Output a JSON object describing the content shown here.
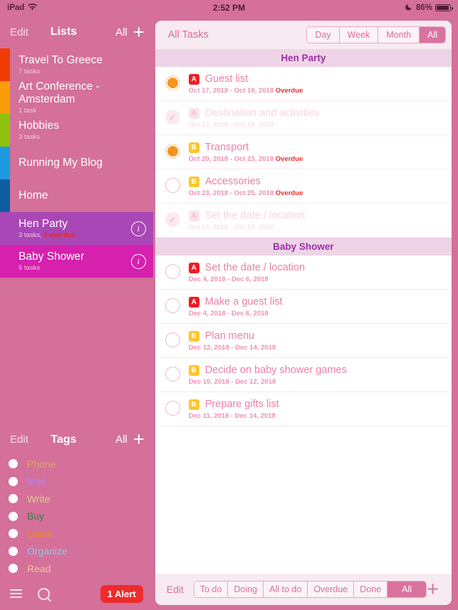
{
  "statusbar": {
    "device": "iPad",
    "wifi_icon": "wifi-icon",
    "time": "2:52 PM",
    "dnd_icon": "moon-icon",
    "battery_text": "86%",
    "battery_level": 86
  },
  "sidebar": {
    "lists_header": {
      "edit_label": "Edit",
      "title": "Lists",
      "all_label": "All",
      "add_label": "+"
    },
    "lists": [
      {
        "name": "Travel To Greece",
        "sub": "7 tasks",
        "overdue": "",
        "color": "#f23c06",
        "selected": false,
        "has_info": false
      },
      {
        "name": "Art Conference - Amsterdam",
        "sub": "1 task",
        "overdue": "",
        "color": "#f99d0b",
        "selected": false,
        "has_info": false
      },
      {
        "name": "Hobbies",
        "sub": "3 tasks",
        "overdue": "",
        "color": "#8fc10d",
        "selected": false,
        "has_info": false
      },
      {
        "name": "Running My Blog",
        "sub": "",
        "overdue": "",
        "color": "#1e9ae0",
        "selected": false,
        "has_info": false
      },
      {
        "name": "Home",
        "sub": "",
        "overdue": "",
        "color": "#0b5f9e",
        "selected": false,
        "has_info": false
      },
      {
        "name": "Hen Party",
        "sub": "3 tasks, ",
        "overdue": "3 overdue",
        "color": "#a847b5",
        "selected": true,
        "has_info": true
      },
      {
        "name": "Baby Shower",
        "sub": "5 tasks",
        "overdue": "",
        "color": "#d521ae",
        "selected": true,
        "has_info": true
      }
    ],
    "tags_header": {
      "edit_label": "Edit",
      "title": "Tags",
      "all_label": "All",
      "add_label": "+"
    },
    "tags": [
      {
        "label": "Phone",
        "color": "#d8a962"
      },
      {
        "label": "Mail",
        "color": "#b183ea"
      },
      {
        "label": "Write",
        "color": "#d8d08a"
      },
      {
        "label": "Buy",
        "color": "#3f7d4e"
      },
      {
        "label": "Learn",
        "color": "#f08c1d"
      },
      {
        "label": "Organize",
        "color": "#93c3e8"
      },
      {
        "label": "Read",
        "color": "#f5c09a"
      }
    ],
    "footer": {
      "menu_icon": "hamburger-menu-icon",
      "search_icon": "search-icon",
      "alert_label": "1 Alert"
    }
  },
  "panel": {
    "header": {
      "title": "All Tasks",
      "segments": [
        {
          "label": "Day",
          "selected": false
        },
        {
          "label": "Week",
          "selected": false
        },
        {
          "label": "Month",
          "selected": false
        },
        {
          "label": "All",
          "selected": true
        }
      ]
    },
    "sections": [
      {
        "title": "Hen Party",
        "tasks": [
          {
            "priority": "A",
            "name": "Guest list",
            "dates": "Oct 17, 2018 - Oct 19, 2018",
            "overdue": "Overdue",
            "state": "doing"
          },
          {
            "priority": "A",
            "name": "Destination and activities",
            "dates": "Oct 17, 2018 - Oct 19, 2018",
            "overdue": "",
            "state": "done"
          },
          {
            "priority": "B",
            "name": "Transport",
            "dates": "Oct 20, 2018 - Oct 23, 2018",
            "overdue": "Overdue",
            "state": "doing"
          },
          {
            "priority": "B",
            "name": "Accessories",
            "dates": "Oct 23, 2018 - Oct 25, 2018",
            "overdue": "Overdue",
            "state": "todo"
          },
          {
            "priority": "A",
            "name": "Set the date / location",
            "dates": "Oct 13, 2018 - Oct 17, 2018",
            "overdue": "",
            "state": "done"
          }
        ]
      },
      {
        "title": "Baby Shower",
        "tasks": [
          {
            "priority": "A",
            "name": "Set the date / location",
            "dates": "Dec 4, 2018 - Dec 6, 2018",
            "overdue": "",
            "state": "todo"
          },
          {
            "priority": "A",
            "name": "Make a guest list",
            "dates": "Dec 4, 2018 - Dec 6, 2018",
            "overdue": "",
            "state": "todo"
          },
          {
            "priority": "B",
            "name": "Plan menu",
            "dates": "Dec 12, 2018 - Dec 14, 2018",
            "overdue": "",
            "state": "todo"
          },
          {
            "priority": "B",
            "name": "Decide on baby shower games",
            "dates": "Dec 10, 2018 - Dec 12, 2018",
            "overdue": "",
            "state": "todo"
          },
          {
            "priority": "B",
            "name": "Prepare gifts list",
            "dates": "Dec 11, 2018 - Dec 14, 2018",
            "overdue": "",
            "state": "todo"
          }
        ]
      }
    ],
    "footer": {
      "edit_label": "Edit",
      "filters": [
        {
          "label": "To do",
          "selected": false
        },
        {
          "label": "Doing",
          "selected": false
        },
        {
          "label": "All to do",
          "selected": false
        },
        {
          "label": "Overdue",
          "selected": false
        },
        {
          "label": "Done",
          "selected": false
        },
        {
          "label": "All",
          "selected": true
        }
      ],
      "add_label": "+"
    }
  }
}
